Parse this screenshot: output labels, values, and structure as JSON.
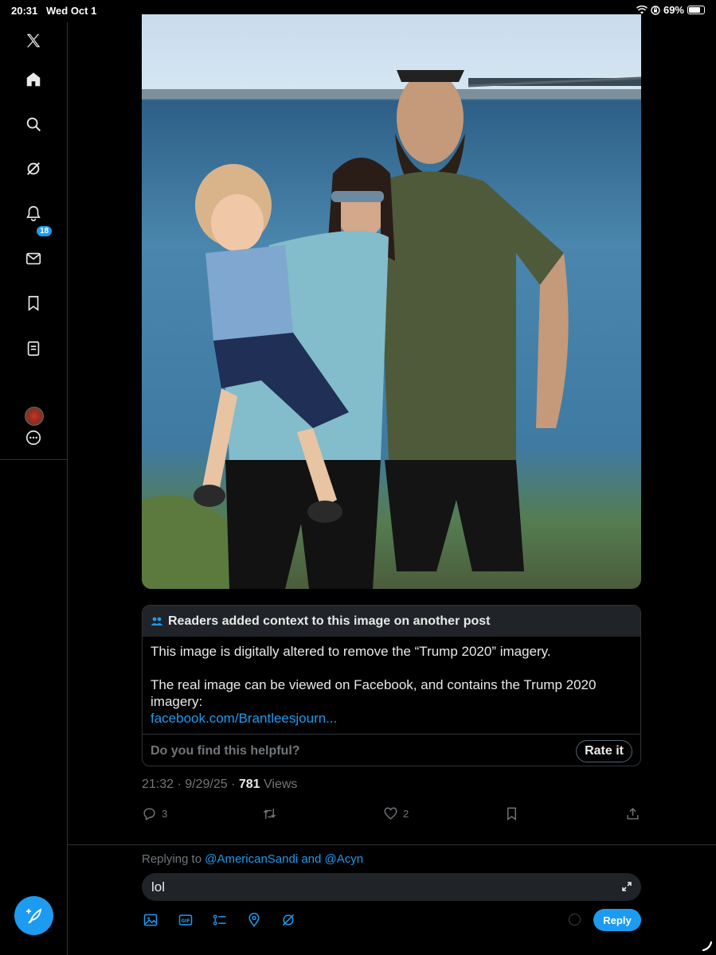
{
  "status_bar": {
    "time": "20:31",
    "date": "Wed Oct 1",
    "battery": "69%",
    "battery_level": 0.69
  },
  "sidebar": {
    "items": [
      "x-logo-icon",
      "home-icon",
      "search-icon",
      "grok-icon",
      "notifications-icon",
      "messages-icon",
      "bookmarks-icon",
      "lists-icon",
      "profile-avatar",
      "more-icon"
    ],
    "notification_badge": "18"
  },
  "community_note": {
    "header": "Readers added context to this image on another post",
    "paragraph1": "This image is digitally altered to remove the “Trump 2020” imagery.",
    "paragraph2": "The real image can be viewed on Facebook, and contains the Trump 2020 imagery:",
    "link": "facebook.com/Brantleesjourn...",
    "question": "Do you find this helpful?",
    "rate_label": "Rate it"
  },
  "post_meta": {
    "time": "21:32",
    "date": "9/29/25",
    "views_count": "781",
    "views_label": "Views"
  },
  "actions": {
    "replies": "3",
    "reposts": "",
    "likes": "2"
  },
  "reply": {
    "replying_prefix": "Replying to",
    "handle1": "@AmericanSandi",
    "and": "and",
    "handle2": "@Acyn",
    "input_value": "lol",
    "button": "Reply"
  },
  "colors": {
    "accent": "#1d9bf0",
    "background": "#000000",
    "muted": "#71767b"
  }
}
